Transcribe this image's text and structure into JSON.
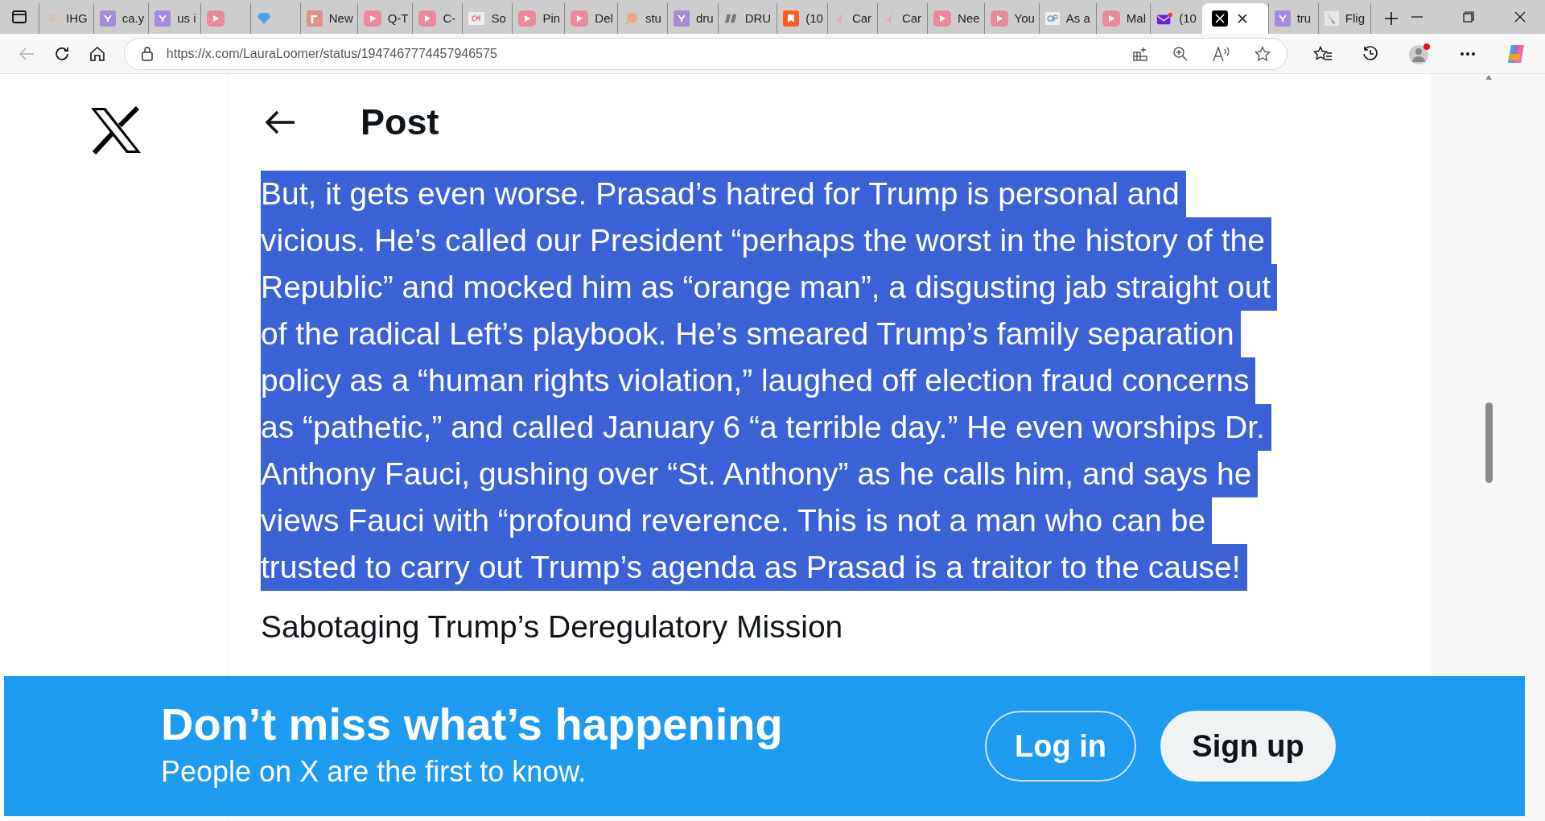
{
  "browser": {
    "tabs": [
      {
        "title": "IHG",
        "kind": "wifi",
        "selected": false
      },
      {
        "title": "ca.y",
        "kind": "yahoo",
        "selected": false
      },
      {
        "title": "us i",
        "kind": "yahoo",
        "selected": false
      },
      {
        "kind": "video",
        "selected": false
      },
      {
        "kind": "gem",
        "selected": false
      },
      {
        "title": "New",
        "kind": "r",
        "selected": false
      },
      {
        "title": "Q-T",
        "kind": "video",
        "selected": false
      },
      {
        "title": "C-",
        "kind": "video",
        "selected": false
      },
      {
        "title": "So",
        "kind": "cm",
        "selected": false
      },
      {
        "title": "Pin",
        "kind": "video",
        "selected": false
      },
      {
        "title": "Del",
        "kind": "video",
        "selected": false
      },
      {
        "title": "stu",
        "kind": "sf",
        "selected": false
      },
      {
        "title": "dru",
        "kind": "yahoo",
        "selected": false
      },
      {
        "title": "DRU",
        "kind": "dr",
        "selected": false
      },
      {
        "title": "(10",
        "kind": "bookmark",
        "selected": false
      },
      {
        "title": "Car",
        "kind": "bird",
        "selected": false
      },
      {
        "title": "Car",
        "kind": "bird",
        "selected": false
      },
      {
        "title": "Nee",
        "kind": "video",
        "selected": false
      },
      {
        "title": "You",
        "kind": "video",
        "selected": false
      },
      {
        "title": "As a",
        "kind": "gp",
        "selected": false
      },
      {
        "title": "Mal",
        "kind": "video",
        "selected": false
      },
      {
        "title": "(10",
        "kind": "mail",
        "selected": false
      },
      {
        "kind": "x",
        "selected": true
      },
      {
        "title": "tru",
        "kind": "yahoo",
        "selected": false
      },
      {
        "title": "Flig",
        "kind": "plane",
        "selected": false
      }
    ],
    "url": "https://x.com/LauraLoomer/status/1947467774457946575"
  },
  "header": {
    "title": "Post"
  },
  "post": {
    "lines": [
      "But, it gets even worse. Prasad’s hatred for Trump is personal and",
      "vicious. He’s called our President “perhaps the worst in the history of the",
      "Republic” and mocked him as “orange man”, a disgusting jab straight out",
      "of the radical Left’s playbook. He’s smeared Trump’s family separation",
      "policy as a “human rights violation,” laughed off election fraud concerns",
      "as “pathetic,” and called January 6 “a terrible day.” He even worships Dr.",
      "Anthony Fauci, gushing over “St. Anthony” as he calls him, and says he",
      "views Fauci with “profound reverence. This is not a man who can be",
      "trusted to carry out Trump’s agenda as Prasad is a traitor to the cause!"
    ],
    "selected": true,
    "heading": "Sabotaging Trump’s Deregulatory Mission"
  },
  "banner": {
    "title": "Don’t miss what’s happening",
    "subtitle": "People on X are the first to know.",
    "buttons": [
      {
        "label": "Log in",
        "kind": "outline"
      },
      {
        "label": "Sign up",
        "kind": "filled"
      }
    ]
  }
}
